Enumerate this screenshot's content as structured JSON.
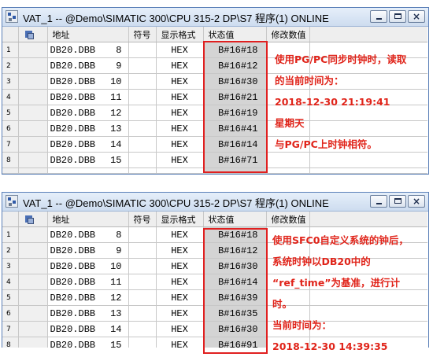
{
  "window1": {
    "title": "VAT_1 -- @Demo\\SIMATIC 300\\CPU 315-2 DP\\S7 程序(1)  ONLINE",
    "headers": {
      "address": "地址",
      "symbol": "符号",
      "format": "显示格式",
      "status": "状态值",
      "modify": "修改数值"
    },
    "rows": [
      {
        "n": "1",
        "addr": "DB20.DBB",
        "off": "8",
        "fmt": "HEX",
        "val": "B#16#18"
      },
      {
        "n": "2",
        "addr": "DB20.DBB",
        "off": "9",
        "fmt": "HEX",
        "val": "B#16#12"
      },
      {
        "n": "3",
        "addr": "DB20.DBB",
        "off": "10",
        "fmt": "HEX",
        "val": "B#16#30"
      },
      {
        "n": "4",
        "addr": "DB20.DBB",
        "off": "11",
        "fmt": "HEX",
        "val": "B#16#21"
      },
      {
        "n": "5",
        "addr": "DB20.DBB",
        "off": "12",
        "fmt": "HEX",
        "val": "B#16#19"
      },
      {
        "n": "6",
        "addr": "DB20.DBB",
        "off": "13",
        "fmt": "HEX",
        "val": "B#16#41"
      },
      {
        "n": "7",
        "addr": "DB20.DBB",
        "off": "14",
        "fmt": "HEX",
        "val": "B#16#14"
      },
      {
        "n": "8",
        "addr": "DB20.DBB",
        "off": "15",
        "fmt": "HEX",
        "val": "B#16#71"
      }
    ],
    "note": [
      "使用PG/PC同步时钟时，读取",
      "的当前时间为：",
      "2018-12-30 21:19:41",
      "星期天",
      "与PG/PC上时钟相符。"
    ]
  },
  "window2": {
    "title": "VAT_1 -- @Demo\\SIMATIC 300\\CPU 315-2 DP\\S7 程序(1)  ONLINE",
    "headers": {
      "address": "地址",
      "symbol": "符号",
      "format": "显示格式",
      "status": "状态值",
      "modify": "修改数值"
    },
    "rows": [
      {
        "n": "1",
        "addr": "DB20.DBB",
        "off": "8",
        "fmt": "HEX",
        "val": "B#16#18"
      },
      {
        "n": "2",
        "addr": "DB20.DBB",
        "off": "9",
        "fmt": "HEX",
        "val": "B#16#12"
      },
      {
        "n": "3",
        "addr": "DB20.DBB",
        "off": "10",
        "fmt": "HEX",
        "val": "B#16#30"
      },
      {
        "n": "4",
        "addr": "DB20.DBB",
        "off": "11",
        "fmt": "HEX",
        "val": "B#16#14"
      },
      {
        "n": "5",
        "addr": "DB20.DBB",
        "off": "12",
        "fmt": "HEX",
        "val": "B#16#39"
      },
      {
        "n": "6",
        "addr": "DB20.DBB",
        "off": "13",
        "fmt": "HEX",
        "val": "B#16#35"
      },
      {
        "n": "7",
        "addr": "DB20.DBB",
        "off": "14",
        "fmt": "HEX",
        "val": "B#16#30"
      },
      {
        "n": "8",
        "addr": "DB20.DBB",
        "off": "15",
        "fmt": "HEX",
        "val": "B#16#91"
      }
    ],
    "note": [
      "使用SFC0自定义系统的钟后，",
      "系统时钟以DB20中的",
      "“ref_time”为基准，进行计",
      "时。",
      "当前时间为：",
      "2018-12-30 14:39:35"
    ]
  },
  "colors": {
    "annotation": "#e0241a",
    "status_cell": "#d4d4d4",
    "title_bar": "#d6e3f4"
  }
}
